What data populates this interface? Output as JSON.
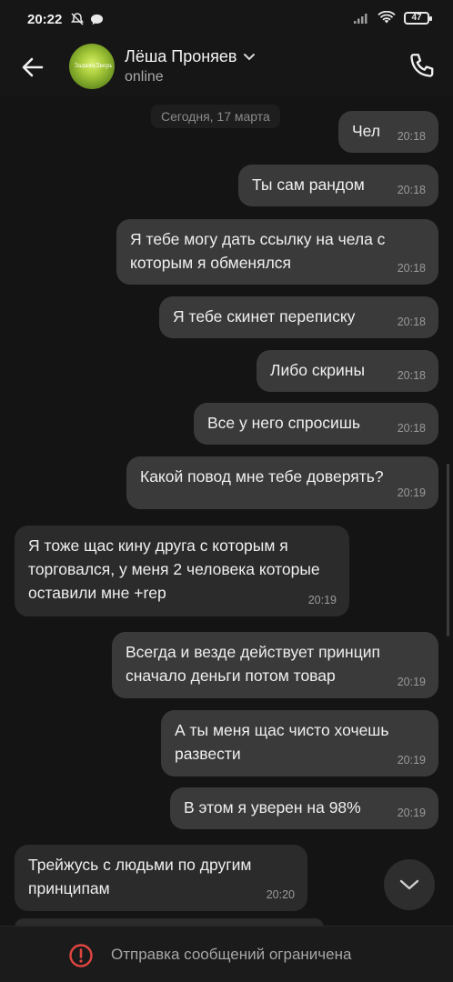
{
  "status_bar": {
    "time": "20:22",
    "battery": "47"
  },
  "header": {
    "contact_name": "Лёша Проняев",
    "presence": "online"
  },
  "date_separator": "Сегодня, 17 марта",
  "messages": [
    {
      "dir": "out",
      "text": "Чел",
      "time": "20:18"
    },
    {
      "dir": "out",
      "text": "Ты сам рандом",
      "time": "20:18"
    },
    {
      "dir": "out",
      "text": "Я тебе могу дать ссылку на чела с которым я обменялся",
      "time": "20:18"
    },
    {
      "dir": "out",
      "text": "Я тебе скинет переписку",
      "time": "20:18"
    },
    {
      "dir": "out",
      "text": "Либо скрины",
      "time": "20:18"
    },
    {
      "dir": "out",
      "text": "Все у него спросишь",
      "time": "20:18"
    },
    {
      "dir": "out",
      "text": "Какой повод мне тебе доверять?",
      "time": "20:19"
    },
    {
      "dir": "in",
      "text": "Я тоже щас кину друга с которым я торговался, у меня 2 человека которые оставили мне +rep",
      "time": "20:19"
    },
    {
      "dir": "out",
      "text": "Всегда и везде действует принцип сначало деньги потом товар",
      "time": "20:19"
    },
    {
      "dir": "out",
      "text": "А ты меня щас чисто хочешь развести",
      "time": "20:19"
    },
    {
      "dir": "out",
      "text": "В этом я уверен на 98%",
      "time": "20:19"
    },
    {
      "dir": "in",
      "text": "Трейжусь с людьми по другим принципам",
      "time": "20:20"
    }
  ],
  "composer": {
    "restriction_text": "Отправка сообщений ограничена"
  },
  "icons": {
    "back": "arrow-left-icon",
    "call": "phone-icon",
    "scroll_down": "chevron-down-icon",
    "warning": "alert-circle-icon"
  },
  "colors": {
    "background": "#141414",
    "bubble_out": "#3a3a3a",
    "bubble_in": "#2b2b2b",
    "warning": "#e0453f"
  }
}
